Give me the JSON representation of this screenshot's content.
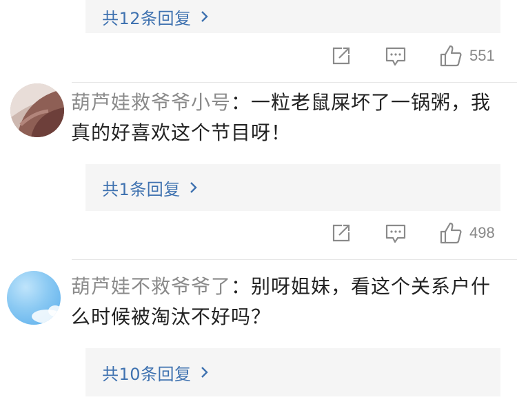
{
  "colors": {
    "reply_link": "#3f72b0",
    "username": "#8a8a8a",
    "comment_text": "#222222",
    "reply_bg": "#f5f5f5",
    "icon_gray": "#8a8a8a"
  },
  "comments": [
    {
      "reply_label": "共12条回复",
      "like_count": "551"
    },
    {
      "username": "葫芦娃救爷爷小号",
      "separator": "：",
      "text": "一粒老鼠屎坏了一锅粥，我真的好喜欢这个节目呀！",
      "reply_label": "共1条回复",
      "like_count": "498"
    },
    {
      "username": "葫芦娃不救爷爷了",
      "separator": "：",
      "text": "别呀姐妹，看这个关系户什么时候被淘汰不好吗？",
      "reply_label": "共10条回复"
    }
  ],
  "icons": {
    "share": "share-icon",
    "comment": "comment-icon",
    "like": "thumbs-up-icon",
    "chevron": "chevron-right-icon"
  }
}
